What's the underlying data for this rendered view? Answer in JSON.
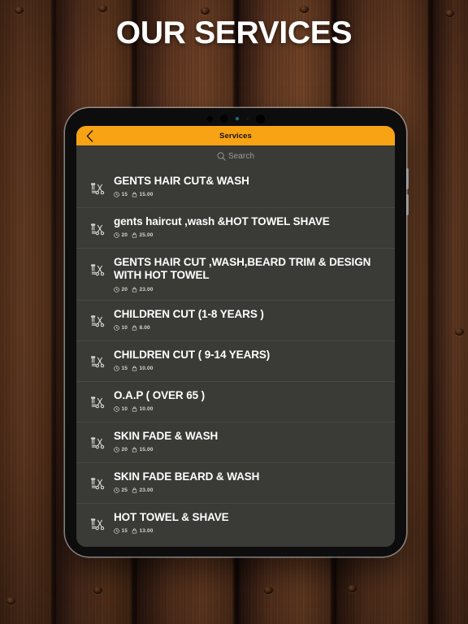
{
  "page": {
    "heading": "OUR SERVICES"
  },
  "device": {
    "name": "tablet-mockup"
  },
  "app": {
    "appbar": {
      "title": "Services",
      "back_icon": "chevron-left-icon"
    },
    "search": {
      "placeholder": "Search",
      "icon": "search-icon",
      "value": ""
    },
    "list_item_icon": "barber-scissors-comb-icon",
    "duration_icon": "clock-icon",
    "price_icon": "price-tag-icon",
    "services": [
      {
        "name": "GENTS HAIR CUT& WASH",
        "duration": "15",
        "price": "15.00"
      },
      {
        "name": "gents haircut ,wash &HOT TOWEL SHAVE",
        "duration": "20",
        "price": "25.00"
      },
      {
        "name": "GENTS HAIR CUT ,WASH,BEARD TRIM & DESIGN WITH HOT TOWEL",
        "duration": "20",
        "price": "23.00"
      },
      {
        "name": "CHILDREN CUT (1-8 YEARS )",
        "duration": "10",
        "price": "8.00"
      },
      {
        "name": "CHILDREN CUT ( 9-14 YEARS)",
        "duration": "15",
        "price": "10.00"
      },
      {
        "name": "O.A.P ( OVER 65 )",
        "duration": "10",
        "price": "10.00"
      },
      {
        "name": "SKIN FADE & WASH",
        "duration": "20",
        "price": "15.00"
      },
      {
        "name": "SKIN FADE BEARD & WASH",
        "duration": "25",
        "price": "23.00"
      },
      {
        "name": "HOT TOWEL & SHAVE",
        "duration": "15",
        "price": "13.00"
      }
    ]
  },
  "colors": {
    "accent": "#f7a313",
    "screen_bg": "#3a3a37",
    "bezel": "#0d0d0e",
    "title_text": "#ffffff",
    "wood": "#4a2a17"
  }
}
